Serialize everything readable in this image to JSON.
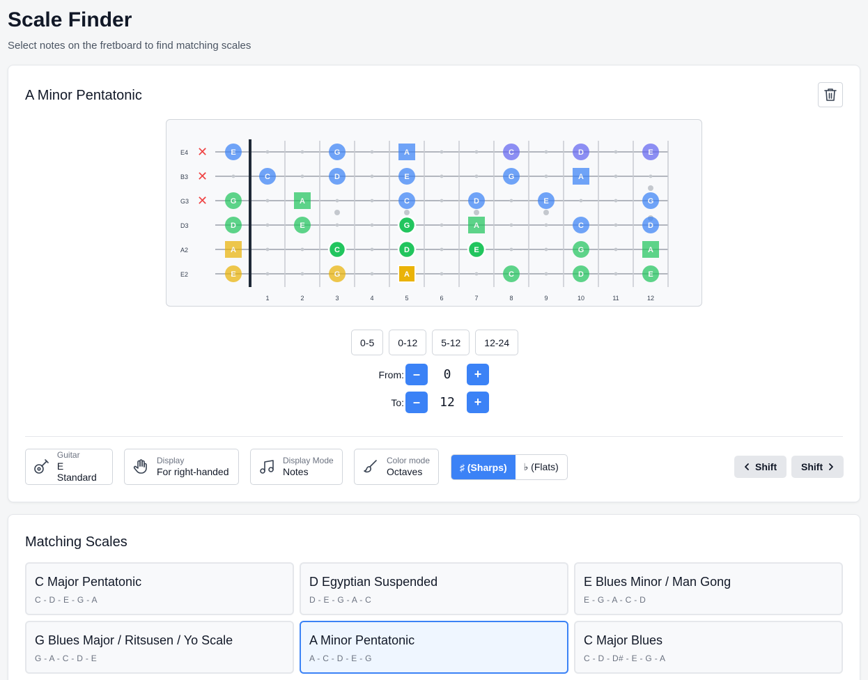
{
  "header": {
    "title": "Scale Finder",
    "subtitle": "Select notes on the fretboard to find matching scales"
  },
  "fretboard_card": {
    "scale_name": "A Minor Pentatonic",
    "strings": [
      "E4",
      "B3",
      "G3",
      "D3",
      "A2",
      "E2"
    ],
    "muted_strings": [
      "E4",
      "B3",
      "G3"
    ],
    "fret_numbers": [
      "1",
      "2",
      "3",
      "4",
      "5",
      "6",
      "7",
      "8",
      "9",
      "10",
      "11",
      "12"
    ],
    "markers": [
      {
        "string": 0,
        "fret": 0,
        "label": "E",
        "color": "#3b82f6",
        "shape": "circle",
        "fade": true
      },
      {
        "string": 0,
        "fret": 3,
        "label": "G",
        "color": "#3b82f6",
        "shape": "circle",
        "fade": true
      },
      {
        "string": 0,
        "fret": 5,
        "label": "A",
        "color": "#3b82f6",
        "shape": "square",
        "fade": true
      },
      {
        "string": 0,
        "fret": 8,
        "label": "C",
        "color": "#6366f1",
        "shape": "circle",
        "fade": true
      },
      {
        "string": 0,
        "fret": 10,
        "label": "D",
        "color": "#6366f1",
        "shape": "circle",
        "fade": true
      },
      {
        "string": 0,
        "fret": 12,
        "label": "E",
        "color": "#6366f1",
        "shape": "circle",
        "fade": true
      },
      {
        "string": 1,
        "fret": 1,
        "label": "C",
        "color": "#3b82f6",
        "shape": "circle",
        "fade": true
      },
      {
        "string": 1,
        "fret": 3,
        "label": "D",
        "color": "#3b82f6",
        "shape": "circle",
        "fade": true
      },
      {
        "string": 1,
        "fret": 5,
        "label": "E",
        "color": "#3b82f6",
        "shape": "circle",
        "fade": true
      },
      {
        "string": 1,
        "fret": 8,
        "label": "G",
        "color": "#3b82f6",
        "shape": "circle",
        "fade": true
      },
      {
        "string": 1,
        "fret": 10,
        "label": "A",
        "color": "#3b82f6",
        "shape": "square",
        "fade": true
      },
      {
        "string": 2,
        "fret": 0,
        "label": "G",
        "color": "#22c55e",
        "shape": "circle",
        "fade": true
      },
      {
        "string": 2,
        "fret": 2,
        "label": "A",
        "color": "#22c55e",
        "shape": "square",
        "fade": true
      },
      {
        "string": 2,
        "fret": 5,
        "label": "C",
        "color": "#3b82f6",
        "shape": "circle",
        "fade": true
      },
      {
        "string": 2,
        "fret": 7,
        "label": "D",
        "color": "#3b82f6",
        "shape": "circle",
        "fade": true
      },
      {
        "string": 2,
        "fret": 9,
        "label": "E",
        "color": "#3b82f6",
        "shape": "circle",
        "fade": true
      },
      {
        "string": 2,
        "fret": 12,
        "label": "G",
        "color": "#3b82f6",
        "shape": "circle",
        "fade": true
      },
      {
        "string": 3,
        "fret": 0,
        "label": "D",
        "color": "#22c55e",
        "shape": "circle",
        "fade": true
      },
      {
        "string": 3,
        "fret": 2,
        "label": "E",
        "color": "#22c55e",
        "shape": "circle",
        "fade": true
      },
      {
        "string": 3,
        "fret": 5,
        "label": "G",
        "color": "#22c55e",
        "shape": "circle",
        "fade": false
      },
      {
        "string": 3,
        "fret": 7,
        "label": "A",
        "color": "#22c55e",
        "shape": "square",
        "fade": true
      },
      {
        "string": 3,
        "fret": 10,
        "label": "C",
        "color": "#3b82f6",
        "shape": "circle",
        "fade": true
      },
      {
        "string": 3,
        "fret": 12,
        "label": "D",
        "color": "#3b82f6",
        "shape": "circle",
        "fade": true
      },
      {
        "string": 4,
        "fret": 0,
        "label": "A",
        "color": "#eab308",
        "shape": "square",
        "fade": true
      },
      {
        "string": 4,
        "fret": 3,
        "label": "C",
        "color": "#22c55e",
        "shape": "circle",
        "fade": false
      },
      {
        "string": 4,
        "fret": 5,
        "label": "D",
        "color": "#22c55e",
        "shape": "circle",
        "fade": false
      },
      {
        "string": 4,
        "fret": 7,
        "label": "E",
        "color": "#22c55e",
        "shape": "circle",
        "fade": false
      },
      {
        "string": 4,
        "fret": 10,
        "label": "G",
        "color": "#22c55e",
        "shape": "circle",
        "fade": true
      },
      {
        "string": 4,
        "fret": 12,
        "label": "A",
        "color": "#22c55e",
        "shape": "square",
        "fade": true
      },
      {
        "string": 5,
        "fret": 0,
        "label": "E",
        "color": "#eab308",
        "shape": "circle",
        "fade": true
      },
      {
        "string": 5,
        "fret": 3,
        "label": "G",
        "color": "#eab308",
        "shape": "circle",
        "fade": true
      },
      {
        "string": 5,
        "fret": 5,
        "label": "A",
        "color": "#eab308",
        "shape": "square",
        "fade": false
      },
      {
        "string": 5,
        "fret": 8,
        "label": "C",
        "color": "#22c55e",
        "shape": "circle",
        "fade": true
      },
      {
        "string": 5,
        "fret": 10,
        "label": "D",
        "color": "#22c55e",
        "shape": "circle",
        "fade": true
      },
      {
        "string": 5,
        "fret": 12,
        "label": "E",
        "color": "#22c55e",
        "shape": "circle",
        "fade": true
      }
    ],
    "range_presets": [
      "0-5",
      "0-12",
      "5-12",
      "12-24"
    ],
    "range": {
      "from_label": "From:",
      "from_value": "0",
      "to_label": "To:",
      "to_value": "12",
      "minus": "–",
      "plus": "+"
    },
    "options": {
      "guitar": {
        "caption": "Guitar",
        "value": "E Standard",
        "icon": "guitar-icon"
      },
      "display": {
        "caption": "Display",
        "value": "For right-handed",
        "icon": "hand-icon"
      },
      "display_mode": {
        "caption": "Display Mode",
        "value": "Notes",
        "icon": "music-note-icon"
      },
      "color_mode": {
        "caption": "Color mode",
        "value": "Octaves",
        "icon": "brush-icon"
      }
    },
    "accidentals": {
      "sharps": "♯ (Sharps)",
      "flats": "♭ (Flats)",
      "selected": "sharps"
    },
    "shift_left": "Shift",
    "shift_right": "Shift",
    "accent_color": "#3b82f6"
  },
  "matching": {
    "title": "Matching Scales",
    "scales": [
      {
        "name": "C Major Pentatonic",
        "notes": "C - D - E - G - A",
        "selected": false
      },
      {
        "name": "D Egyptian Suspended",
        "notes": "D - E - G - A - C",
        "selected": false
      },
      {
        "name": "E Blues Minor / Man Gong",
        "notes": "E - G - A - C - D",
        "selected": false
      },
      {
        "name": "G Blues Major / Ritsusen / Yo Scale",
        "notes": "G - A - C - D - E",
        "selected": false
      },
      {
        "name": "A Minor Pentatonic",
        "notes": "A - C - D - E - G",
        "selected": true
      },
      {
        "name": "C Major Blues",
        "notes": "C - D - D# - E - G - A",
        "selected": false
      }
    ]
  }
}
